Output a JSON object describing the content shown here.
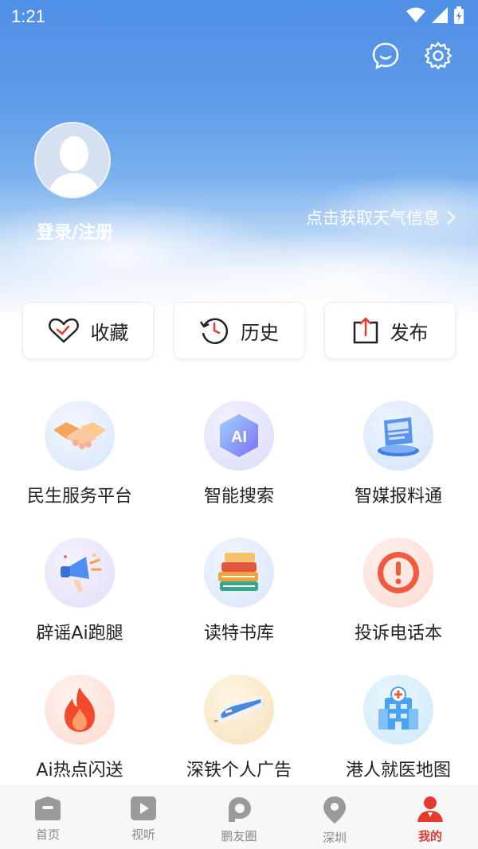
{
  "status_bar": {
    "time": "1:21"
  },
  "profile": {
    "login_label": "登录/注册",
    "weather_label": "点击获取天气信息"
  },
  "quick_actions": [
    {
      "label": "收藏",
      "icon": "heart-icon"
    },
    {
      "label": "历史",
      "icon": "history-clock-icon"
    },
    {
      "label": "发布",
      "icon": "upload-icon"
    }
  ],
  "services": [
    {
      "label": "民生服务平台",
      "icon": "handshake-icon"
    },
    {
      "label": "智能搜索",
      "icon": "ai-icon"
    },
    {
      "label": "智媒报料通",
      "icon": "news-report-icon"
    },
    {
      "label": "辟谣Ai跑腿",
      "icon": "megaphone-icon"
    },
    {
      "label": "读特书库",
      "icon": "books-icon"
    },
    {
      "label": "投诉电话本",
      "icon": "alert-icon"
    },
    {
      "label": "Ai热点闪送",
      "icon": "flame-icon"
    },
    {
      "label": "深铁个人广告",
      "icon": "train-icon"
    },
    {
      "label": "港人就医地图",
      "icon": "hospital-icon"
    }
  ],
  "tabs": [
    {
      "label": "首页",
      "icon": "home-icon"
    },
    {
      "label": "视听",
      "icon": "play-icon"
    },
    {
      "label": "鹏友圈",
      "icon": "circle-p-icon"
    },
    {
      "label": "深圳",
      "icon": "location-pin-icon"
    },
    {
      "label": "我的",
      "icon": "person-icon"
    }
  ],
  "colors": {
    "accent": "#e53a2d",
    "hero_top": "#4f8fe6",
    "tab_inactive": "#888888"
  }
}
